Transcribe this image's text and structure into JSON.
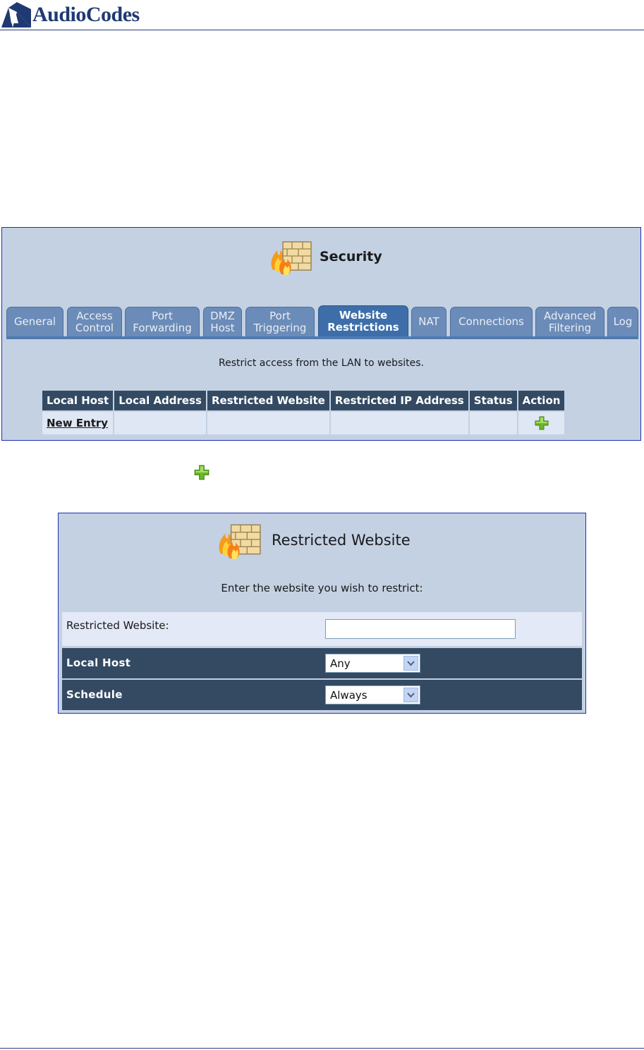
{
  "header": {
    "logo_text": "AudioCodes"
  },
  "security_panel": {
    "title": "Security",
    "tabs": [
      {
        "label_line1": "General",
        "label_line2": ""
      },
      {
        "label_line1": "Access",
        "label_line2": "Control"
      },
      {
        "label_line1": "Port",
        "label_line2": "Forwarding"
      },
      {
        "label_line1": "DMZ",
        "label_line2": "Host"
      },
      {
        "label_line1": "Port",
        "label_line2": "Triggering"
      },
      {
        "label_line1": "Website",
        "label_line2": "Restrictions"
      },
      {
        "label_line1": "NAT",
        "label_line2": ""
      },
      {
        "label_line1": "Connections",
        "label_line2": ""
      },
      {
        "label_line1": "Advanced",
        "label_line2": "Filtering"
      },
      {
        "label_line1": "Log",
        "label_line2": ""
      }
    ],
    "active_tab": "Website Restrictions",
    "description": "Restrict access from the LAN to websites.",
    "table": {
      "headers": [
        "Local Host",
        "Local Address",
        "Restricted Website",
        "Restricted IP Address",
        "Status",
        "Action"
      ],
      "new_entry_label": "New Entry"
    }
  },
  "restricted_website_panel": {
    "title": "Restricted Website",
    "description": "Enter the website you wish to restrict:",
    "website_label": "Restricted Website:",
    "website_value": "",
    "local_host_label": "Local Host",
    "local_host_value": "Any",
    "schedule_label": "Schedule",
    "schedule_value": "Always"
  },
  "colors": {
    "panel_bg": "#c3d1e3",
    "tab_bg": "#6b8cb8",
    "tab_active_bg": "#3e6ea9",
    "header_cell_bg": "#344a63",
    "plus_green": "#6cb82a"
  }
}
